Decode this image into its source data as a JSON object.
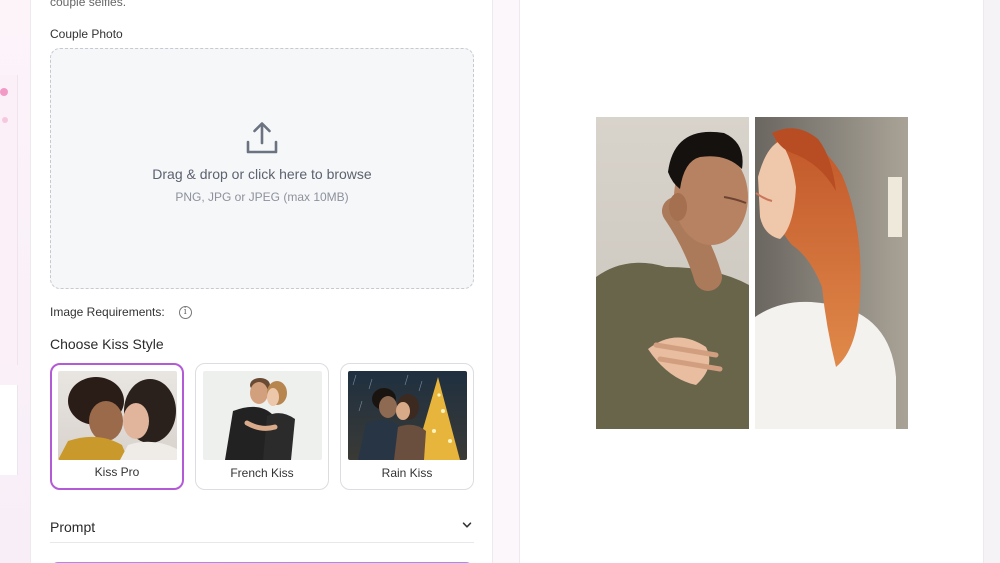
{
  "top_text": "couple selfies.",
  "upload": {
    "label": "Couple Photo",
    "title": "Drag & drop or click here to browse",
    "subtitle": "PNG, JPG or JPEG (max 10MB)",
    "icon": "upload-icon"
  },
  "requirements": {
    "label": "Image Requirements:",
    "icon": "info-icon"
  },
  "kiss_style": {
    "title": "Choose Kiss Style",
    "selected": "Kiss Pro",
    "options": [
      {
        "label": "Kiss Pro"
      },
      {
        "label": "French Kiss"
      },
      {
        "label": "Rain Kiss"
      }
    ]
  },
  "prompt": {
    "label": "Prompt",
    "icon": "chevron-down-icon"
  },
  "colors": {
    "accent": "#b35ad6",
    "cta": "#b784f0"
  }
}
